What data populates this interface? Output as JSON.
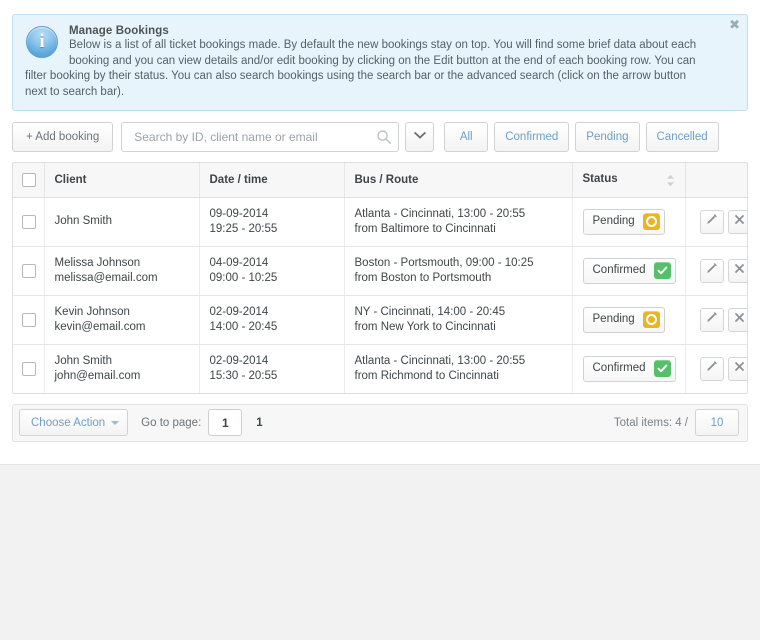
{
  "alert": {
    "title": "Manage Bookings",
    "line1": "Below is a list of all ticket bookings made. By default the new bookings stay on top. You will find some brief data about each",
    "line2": "booking and you can view details and/or edit booking by clicking on the Edit button at the end of each booking row. You can",
    "line3": "filter booking by their status. You can also search bookings using the search bar or the advanced search (click on the arrow button",
    "line4": "next to search bar).",
    "close_label": "✖",
    "icon": "info-icon"
  },
  "toolbar": {
    "add_label": "+ Add booking",
    "search_placeholder": "Search by ID, client name or email",
    "search_value": "",
    "search_icon": "search-icon",
    "advanced_caret_icon": "chevron-down-icon",
    "filters": [
      {
        "label": "All",
        "name": "all"
      },
      {
        "label": "Confirmed",
        "name": "confirmed"
      },
      {
        "label": "Pending",
        "name": "pending"
      },
      {
        "label": "Cancelled",
        "name": "cancelled"
      }
    ]
  },
  "table": {
    "columns": [
      {
        "label": "",
        "name": "select"
      },
      {
        "label": "Client",
        "name": "client"
      },
      {
        "label": "Date / time",
        "name": "date-time"
      },
      {
        "label": "Bus / Route",
        "name": "bus-route"
      },
      {
        "label": "Status",
        "name": "status",
        "sortable": true
      },
      {
        "label": "",
        "name": "actions"
      }
    ],
    "rows": [
      {
        "client_name": "John Smith",
        "client_email": "",
        "date": "09-09-2014",
        "time": "19:25 - 20:55",
        "route_line1": "Atlanta - Cincinnati, 13:00 - 20:55",
        "route_line2": "from Baltimore to Cincinnati",
        "status": "Pending",
        "status_kind": "pending"
      },
      {
        "client_name": "Melissa Johnson",
        "client_email": "melissa@email.com",
        "date": "04-09-2014",
        "time": "09:00 - 10:25",
        "route_line1": "Boston - Portsmouth, 09:00 - 10:25",
        "route_line2": "from Boston to Portsmouth",
        "status": "Confirmed",
        "status_kind": "confirmed"
      },
      {
        "client_name": "Kevin Johnson",
        "client_email": "kevin@email.com",
        "date": "02-09-2014",
        "time": "14:00 - 20:45",
        "route_line1": "NY - Cincinnati, 14:00 - 20:45",
        "route_line2": "from New York to Cincinnati",
        "status": "Pending",
        "status_kind": "pending"
      },
      {
        "client_name": "John Smith",
        "client_email": "john@email.com",
        "date": "02-09-2014",
        "time": "15:30 - 20:55",
        "route_line1": "Atlanta - Cincinnati, 13:00 - 20:55",
        "route_line2": "from Richmond to Cincinnati",
        "status": "Confirmed",
        "status_kind": "confirmed"
      }
    ],
    "row_actions": {
      "edit_icon": "pencil-icon",
      "delete_icon": "close-x-icon"
    }
  },
  "footer": {
    "choose_action_label": "Choose Action",
    "goto_label": "Go to page:",
    "page_value": "1",
    "total_pages": "1",
    "total_items_label": "Total items: 4 /",
    "per_page": "10"
  },
  "colors": {
    "accent_blue": "#6d9fc4",
    "alert_bg": "#e8f4fb",
    "alert_border": "#bfe0f2",
    "status_pending": "#e8b623",
    "status_confirmed": "#56bf6a",
    "status_cancelled": "#d9534f",
    "page_bg": "#f2f2f2"
  }
}
